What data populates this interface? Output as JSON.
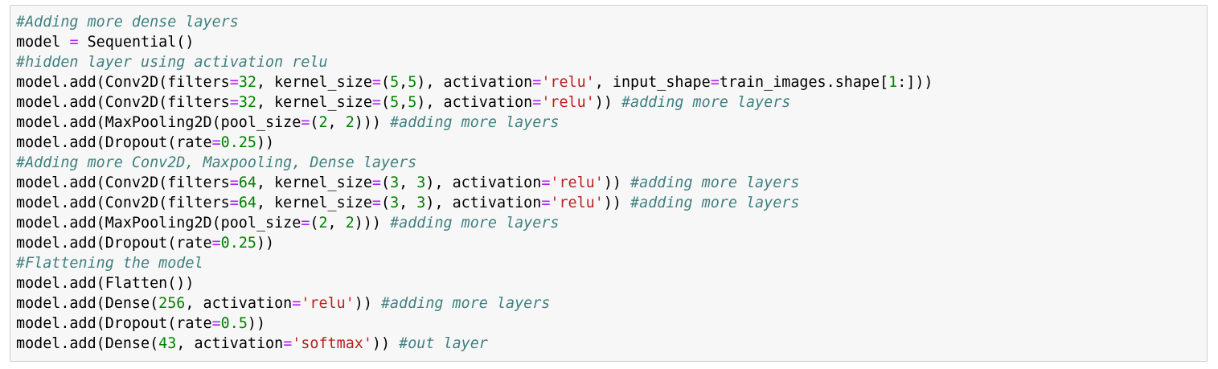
{
  "editor": {
    "language": "python",
    "colors": {
      "background": "#f7f7f7",
      "border": "#cfcfcf",
      "comment": "#408080",
      "operator": "#aa22ff",
      "number": "#008000",
      "string": "#ba2121",
      "text": "#000000"
    },
    "lines": [
      [
        [
          "c",
          "#Adding more dense layers"
        ]
      ],
      [
        [
          "t",
          "model "
        ],
        [
          "o",
          "="
        ],
        [
          "t",
          " Sequential()"
        ]
      ],
      [
        [
          "c",
          "#hidden layer using activation relu"
        ]
      ],
      [
        [
          "t",
          "model.add(Conv2D(filters"
        ],
        [
          "o",
          "="
        ],
        [
          "n",
          "32"
        ],
        [
          "t",
          ", kernel_size"
        ],
        [
          "o",
          "="
        ],
        [
          "t",
          "("
        ],
        [
          "n",
          "5"
        ],
        [
          "t",
          ","
        ],
        [
          "n",
          "5"
        ],
        [
          "t",
          "), activation"
        ],
        [
          "o",
          "="
        ],
        [
          "s",
          "'relu'"
        ],
        [
          "t",
          ", input_shape"
        ],
        [
          "o",
          "="
        ],
        [
          "t",
          "train_images.shape["
        ],
        [
          "n",
          "1"
        ],
        [
          "t",
          ":]))"
        ]
      ],
      [
        [
          "t",
          "model.add(Conv2D(filters"
        ],
        [
          "o",
          "="
        ],
        [
          "n",
          "32"
        ],
        [
          "t",
          ", kernel_size"
        ],
        [
          "o",
          "="
        ],
        [
          "t",
          "("
        ],
        [
          "n",
          "5"
        ],
        [
          "t",
          ","
        ],
        [
          "n",
          "5"
        ],
        [
          "t",
          "), activation"
        ],
        [
          "o",
          "="
        ],
        [
          "s",
          "'relu'"
        ],
        [
          "t",
          ")) "
        ],
        [
          "c",
          "#adding more layers"
        ]
      ],
      [
        [
          "t",
          "model.add(MaxPooling2D(pool_size"
        ],
        [
          "o",
          "="
        ],
        [
          "t",
          "("
        ],
        [
          "n",
          "2"
        ],
        [
          "t",
          ", "
        ],
        [
          "n",
          "2"
        ],
        [
          "t",
          "))) "
        ],
        [
          "c",
          "#adding more layers"
        ]
      ],
      [
        [
          "t",
          "model.add(Dropout(rate"
        ],
        [
          "o",
          "="
        ],
        [
          "n",
          "0.25"
        ],
        [
          "t",
          "))"
        ]
      ],
      [
        [
          "c",
          "#Adding more Conv2D, Maxpooling, Dense layers"
        ]
      ],
      [
        [
          "t",
          "model.add(Conv2D(filters"
        ],
        [
          "o",
          "="
        ],
        [
          "n",
          "64"
        ],
        [
          "t",
          ", kernel_size"
        ],
        [
          "o",
          "="
        ],
        [
          "t",
          "("
        ],
        [
          "n",
          "3"
        ],
        [
          "t",
          ", "
        ],
        [
          "n",
          "3"
        ],
        [
          "t",
          "), activation"
        ],
        [
          "o",
          "="
        ],
        [
          "s",
          "'relu'"
        ],
        [
          "t",
          ")) "
        ],
        [
          "c",
          "#adding more layers"
        ]
      ],
      [
        [
          "t",
          "model.add(Conv2D(filters"
        ],
        [
          "o",
          "="
        ],
        [
          "n",
          "64"
        ],
        [
          "t",
          ", kernel_size"
        ],
        [
          "o",
          "="
        ],
        [
          "t",
          "("
        ],
        [
          "n",
          "3"
        ],
        [
          "t",
          ", "
        ],
        [
          "n",
          "3"
        ],
        [
          "t",
          "), activation"
        ],
        [
          "o",
          "="
        ],
        [
          "s",
          "'relu'"
        ],
        [
          "t",
          ")) "
        ],
        [
          "c",
          "#adding more layers"
        ]
      ],
      [
        [
          "t",
          "model.add(MaxPooling2D(pool_size"
        ],
        [
          "o",
          "="
        ],
        [
          "t",
          "("
        ],
        [
          "n",
          "2"
        ],
        [
          "t",
          ", "
        ],
        [
          "n",
          "2"
        ],
        [
          "t",
          "))) "
        ],
        [
          "c",
          "#adding more layers"
        ]
      ],
      [
        [
          "t",
          "model.add(Dropout(rate"
        ],
        [
          "o",
          "="
        ],
        [
          "n",
          "0.25"
        ],
        [
          "t",
          "))"
        ]
      ],
      [
        [
          "c",
          "#Flattening the model"
        ]
      ],
      [
        [
          "t",
          "model.add(Flatten())"
        ]
      ],
      [
        [
          "t",
          "model.add(Dense("
        ],
        [
          "n",
          "256"
        ],
        [
          "t",
          ", activation"
        ],
        [
          "o",
          "="
        ],
        [
          "s",
          "'relu'"
        ],
        [
          "t",
          ")) "
        ],
        [
          "c",
          "#adding more layers"
        ]
      ],
      [
        [
          "t",
          "model.add(Dropout(rate"
        ],
        [
          "o",
          "="
        ],
        [
          "n",
          "0.5"
        ],
        [
          "t",
          "))"
        ]
      ],
      [
        [
          "t",
          "model.add(Dense("
        ],
        [
          "n",
          "43"
        ],
        [
          "t",
          ", activation"
        ],
        [
          "o",
          "="
        ],
        [
          "s",
          "'softmax'"
        ],
        [
          "t",
          ")) "
        ],
        [
          "c",
          "#out layer"
        ]
      ]
    ]
  }
}
